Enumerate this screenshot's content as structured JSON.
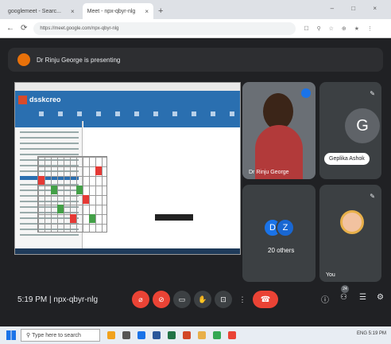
{
  "browser": {
    "tabs": [
      {
        "label": "googlemeet - Searc..."
      },
      {
        "label": "Meet - npx-qbyr-nlg",
        "active": true
      }
    ],
    "new_tab_label": "+",
    "window_controls": "– □ ×",
    "url": "https://meet.google.com/npx-qbyr-nlg",
    "ext_icons": "☐ ⚲ ☆ ⊕ ★ ⋮"
  },
  "presenting_banner": {
    "text": "Dr Rinju George is presenting"
  },
  "shared_screen": {
    "app_title": "dsskcreo"
  },
  "participants": [
    {
      "name": "Dr Rinju George",
      "tile": "video"
    },
    {
      "name": "Geplika Ashok",
      "initial": "G"
    },
    {
      "name": "20 others",
      "avatars": [
        "D",
        "Z"
      ]
    },
    {
      "name": "You"
    }
  ],
  "controls": {
    "time": "5:19 PM",
    "separator": "|",
    "meeting_code": "npx-qbyr-nlg",
    "buttons": [
      "mic-off",
      "camera-off",
      "captions",
      "raise-hand",
      "present",
      "more"
    ],
    "end_call": "end-call",
    "people_count": "24",
    "colors": {
      "danger": "#ea4335",
      "accent": "#1a73e8",
      "bg": "#202124"
    }
  },
  "taskbar": {
    "search_placeholder": "Type here to search",
    "tray_text": "ENG 5:19 PM"
  }
}
